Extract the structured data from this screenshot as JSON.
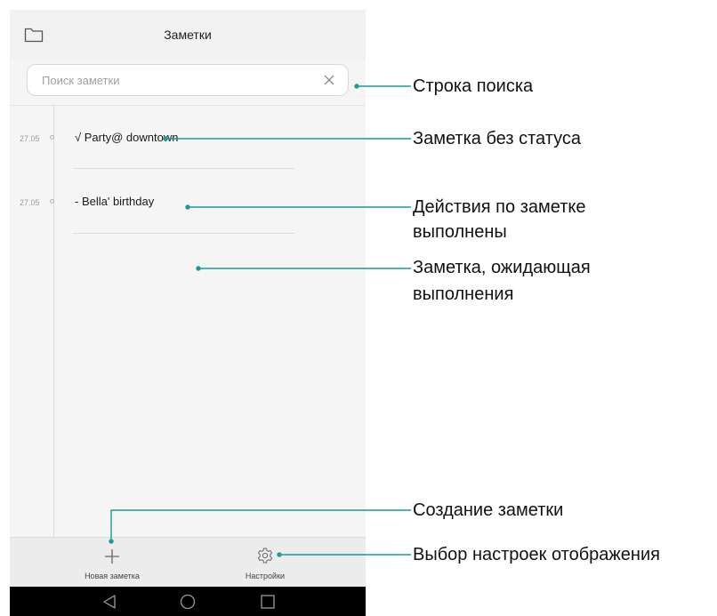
{
  "header": {
    "title": "Заметки"
  },
  "search": {
    "placeholder": "Поиск заметки"
  },
  "notes": [
    {
      "date": "27.05",
      "text": "√ Party@ downtown"
    },
    {
      "date": "27.05",
      "text": "- Bella' birthday"
    }
  ],
  "toolbar": {
    "new_note_label": "Новая заметка",
    "settings_label": "Настройки"
  },
  "callouts": {
    "search_bar": "Строка поиска",
    "note_no_status": "Заметка без статуса",
    "note_done_line1": "Действия по заметке",
    "note_done_line2": "выполнены",
    "note_pending_line1": "Заметка, ожидающая",
    "note_pending_line2": "выполнения",
    "create_note": "Создание заметки",
    "display_settings": "Выбор настроек отображения"
  },
  "colors": {
    "accent": "#1a9a9a",
    "navbar": "#000000"
  },
  "icons": [
    "folder-icon",
    "clear-icon",
    "plus-icon",
    "gear-icon",
    "back-icon",
    "home-icon",
    "recents-icon"
  ]
}
